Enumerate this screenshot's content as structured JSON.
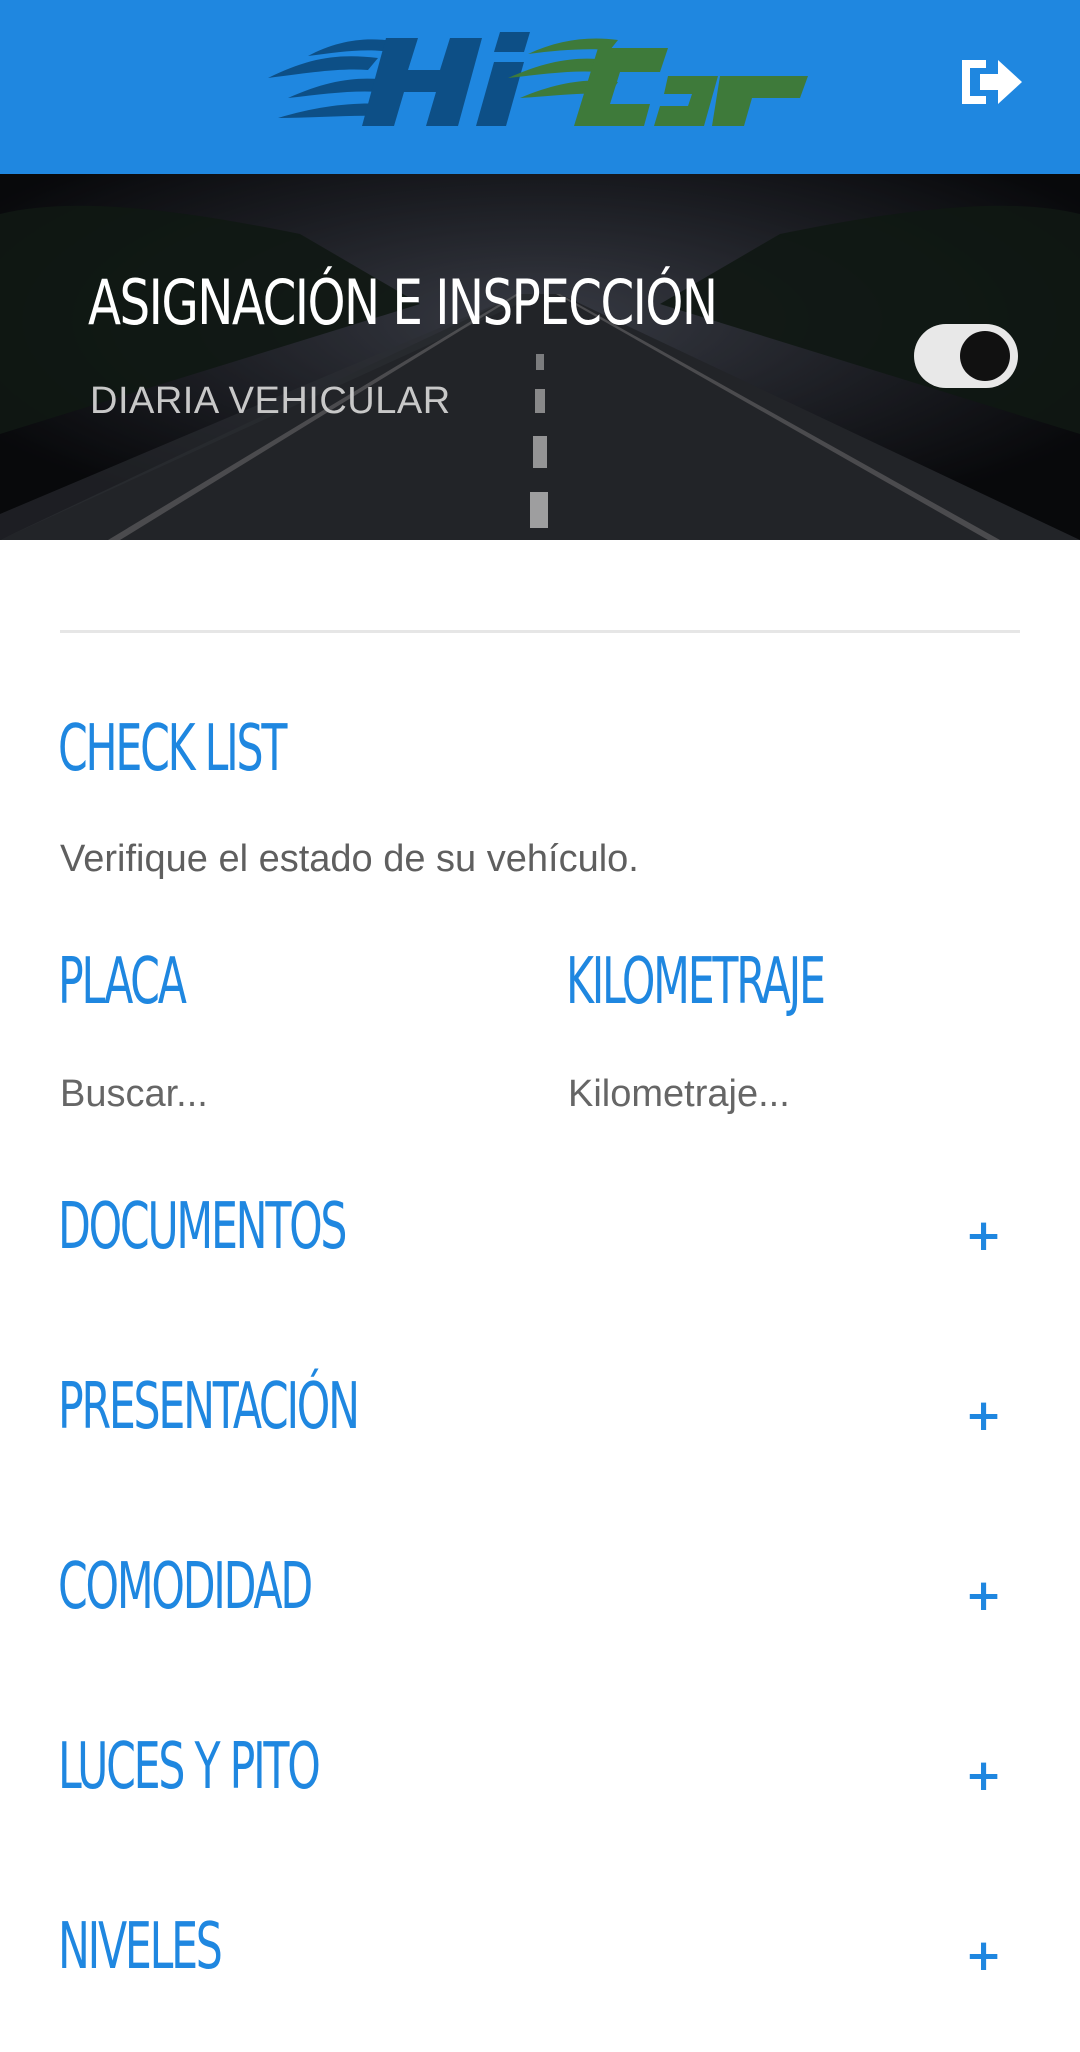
{
  "header": {
    "logo_text": "HiCar",
    "logout_icon": "logout-icon",
    "colors": {
      "bar": "#1f87e0",
      "logo_left": "#0d4f86",
      "logo_right": "#3e7a3a"
    }
  },
  "hero": {
    "title": "ASIGNACIÓN E INSPECCIÓN",
    "subtitle": "DIARIA VEHICULAR",
    "toggle_on": true
  },
  "checklist": {
    "title": "CHECK LIST",
    "description": "Verifique el estado de su vehículo.",
    "placa_label": "PLACA",
    "placa_placeholder": "Buscar...",
    "km_label": "KILOMETRAJE",
    "km_placeholder": "Kilometraje..."
  },
  "sections": [
    {
      "label": "DOCUMENTOS",
      "icon": "+"
    },
    {
      "label": "PRESENTACIÓN",
      "icon": "+"
    },
    {
      "label": "COMODIDAD",
      "icon": "+"
    },
    {
      "label": "LUCES Y PITO",
      "icon": "+"
    },
    {
      "label": "NIVELES",
      "icon": "+"
    }
  ]
}
